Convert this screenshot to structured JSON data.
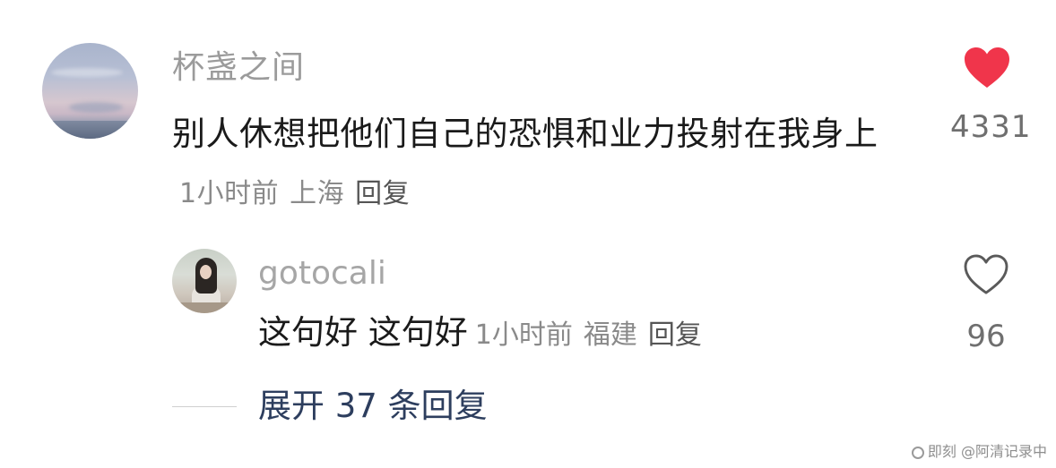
{
  "main_comment": {
    "username": "杯盏之间",
    "text": "别人休想把他们自己的恐惧和业力投射在我身上",
    "time": "1小时前",
    "location": "上海",
    "reply_label": "回复",
    "like_count": "4331",
    "like_icon": "heart-filled-icon",
    "liked": true
  },
  "reply_comment": {
    "username": "gotocali",
    "text": "这句好 这句好",
    "time": "1小时前",
    "location": "福建",
    "reply_label": "回复",
    "like_count": "96",
    "like_icon": "heart-outline-icon",
    "liked": false
  },
  "expand_replies": {
    "label": "展开 37 条回复"
  },
  "watermark": {
    "text": "即刻 @阿清记录中"
  },
  "colors": {
    "heart_red": "#f0354b",
    "link_blue": "#2d3e5e",
    "meta_gray": "#8a8a8a"
  }
}
